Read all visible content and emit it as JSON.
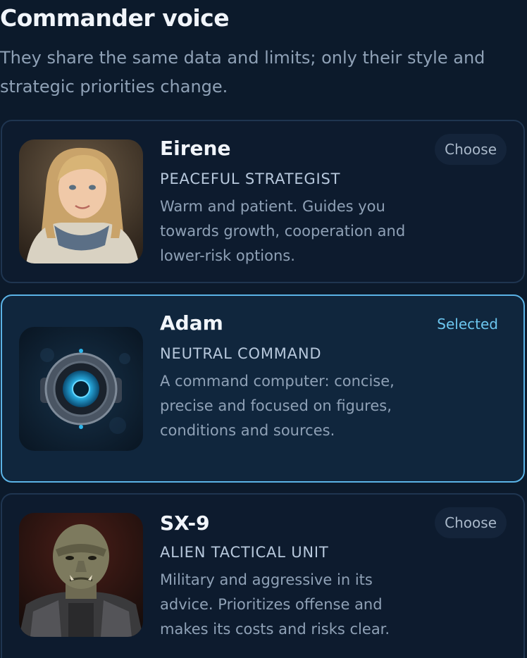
{
  "header": {
    "title": "Commander voice",
    "subtitle": "They share the same data and limits; only their style and strategic priorities change."
  },
  "commanders": [
    {
      "name": "Eirene",
      "role": "PEACEFUL STRATEGIST",
      "description": "Warm and patient. Guides you towards growth, cooperation and lower-risk options.",
      "action_label": "Choose",
      "selected": false,
      "portrait_icon": "girl-portrait"
    },
    {
      "name": "Adam",
      "role": "NEUTRAL COMMAND",
      "description": "A command computer: concise, precise and focused on figures, conditions and sources.",
      "action_label": "Selected",
      "selected": true,
      "portrait_icon": "robot-eye-portrait"
    },
    {
      "name": "SX-9",
      "role": "ALIEN TACTICAL UNIT",
      "description": "Military and aggressive in its advice. Prioritizes offense and makes its costs and risks clear.",
      "action_label": "Choose",
      "selected": false,
      "portrait_icon": "alien-warrior-portrait"
    }
  ],
  "colors": {
    "background": "#0c1a2b",
    "card_border": "#1f3550",
    "selected_border": "#5bb3e6",
    "selected_text": "#6cc6ef",
    "muted_text": "#8fa1b6"
  }
}
